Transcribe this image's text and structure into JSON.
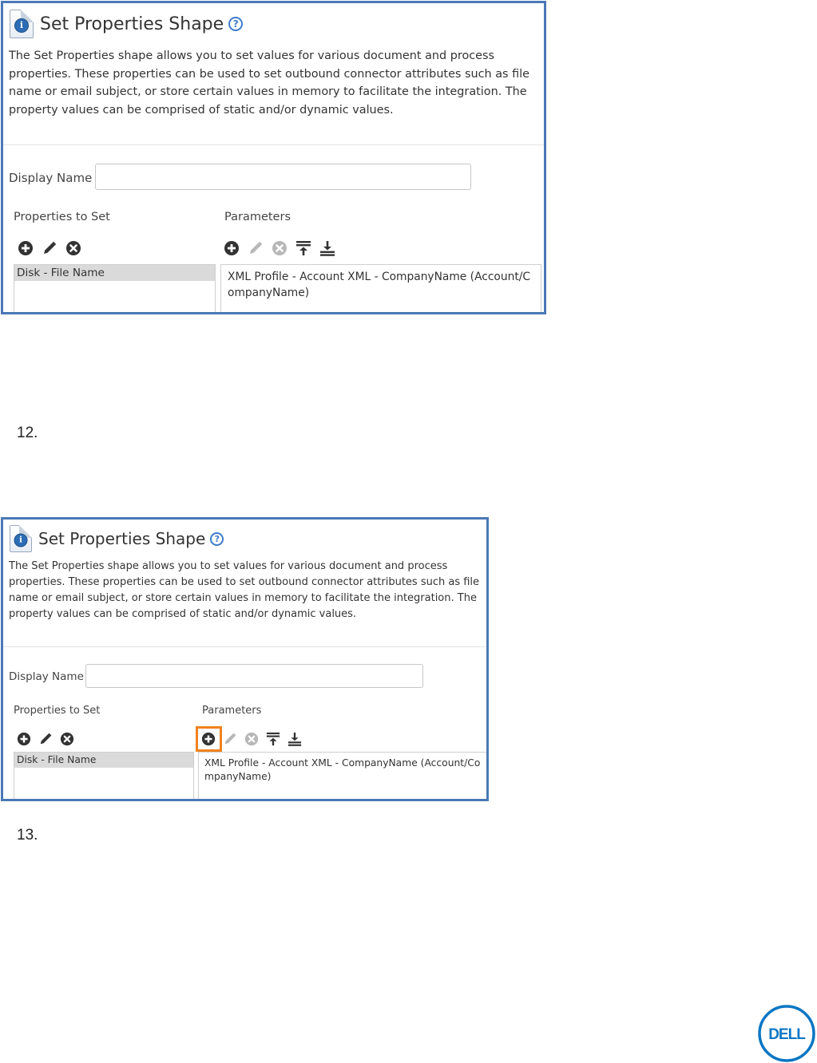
{
  "panels": [
    {
      "title": "Set Properties Shape",
      "help_icon": "question-circle-icon",
      "description": "The Set Properties shape allows you to set values for various document and process properties. These properties can be used to set outbound connector attributes such as file name or email subject, or store certain values in memory to facilitate the integration. The property values can be comprised of static and/or dynamic values.",
      "display_name_label": "Display Name",
      "display_name_value": "",
      "properties_label": "Properties to Set",
      "parameters_label": "Parameters",
      "properties": [
        "Disk - File Name"
      ],
      "parameters": [
        "XML Profile - Account XML - CompanyName (Account/CompanyName)"
      ],
      "add_highlighted": false
    },
    {
      "title": "Set Properties Shape",
      "help_icon": "question-circle-icon",
      "description": "The Set Properties shape allows you to set values for various document and process properties. These properties can be used to set outbound connector attributes such as file name or email subject, or store certain values in memory to facilitate the integration. The property values can be comprised of static and/or dynamic values.",
      "display_name_label": "Display Name",
      "display_name_value": "",
      "properties_label": "Properties to Set",
      "parameters_label": "Parameters",
      "properties": [
        "Disk - File Name"
      ],
      "parameters": [
        "XML Profile - Account XML - CompanyName (Account/CompanyName)"
      ],
      "add_highlighted": true
    }
  ],
  "steps": [
    "12.",
    "13."
  ],
  "colors": {
    "panel_border": "#4a78b5",
    "highlight": "#f0821e",
    "brand": "#0a76c4"
  },
  "logo": {
    "text": "DELL",
    "icon": "dell-logo-icon"
  }
}
